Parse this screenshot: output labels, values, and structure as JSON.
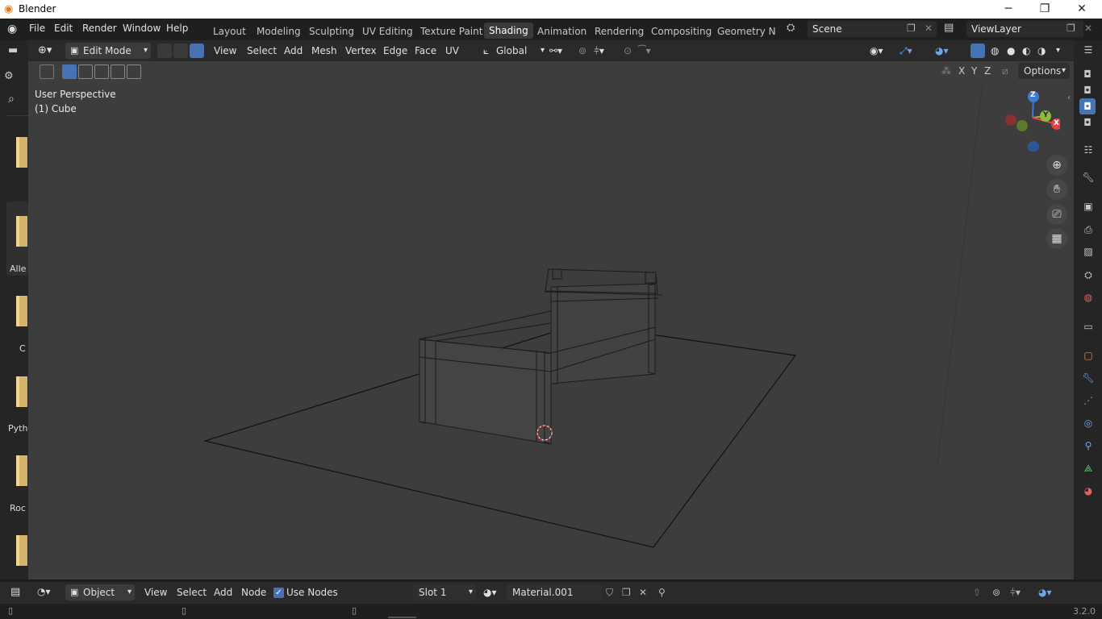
{
  "app": {
    "title": "Blender",
    "version": "3.2.0"
  },
  "menu": [
    "File",
    "Edit",
    "Render",
    "Window",
    "Help"
  ],
  "workspaces": [
    "Layout",
    "Modeling",
    "Sculpting",
    "UV Editing",
    "Texture Paint",
    "Shading",
    "Animation",
    "Rendering",
    "Compositing",
    "Geometry Noc"
  ],
  "active_workspace": "Shading",
  "scene": {
    "name": "Scene",
    "view_layer": "ViewLayer"
  },
  "viewport_header": {
    "mode": "Edit Mode",
    "menus": [
      "View",
      "Select",
      "Add",
      "Mesh",
      "Vertex",
      "Edge",
      "Face",
      "UV"
    ],
    "orientation": "Global",
    "axes": [
      "X",
      "Y",
      "Z"
    ],
    "options": "Options"
  },
  "viewport": {
    "perspective": "User Perspective",
    "object": "(1) Cube"
  },
  "gizmo": {
    "z": "Z",
    "y": "Y",
    "x": "X"
  },
  "left_panel": {
    "labels": [
      "Alle",
      "C",
      "Pyth",
      "Roc"
    ]
  },
  "node_header": {
    "object_mode": "Object",
    "menus": [
      "View",
      "Select",
      "Add",
      "Node"
    ],
    "use_nodes": "Use Nodes",
    "use_nodes_checked": true,
    "slot": "Slot 1",
    "material": "Material.001"
  },
  "colors": {
    "accent": "#4772b3",
    "active_ws": "#3a3a3a",
    "x_axis": "#e8413e",
    "y_axis": "#8fb93c",
    "z_axis": "#3f7bd6"
  }
}
